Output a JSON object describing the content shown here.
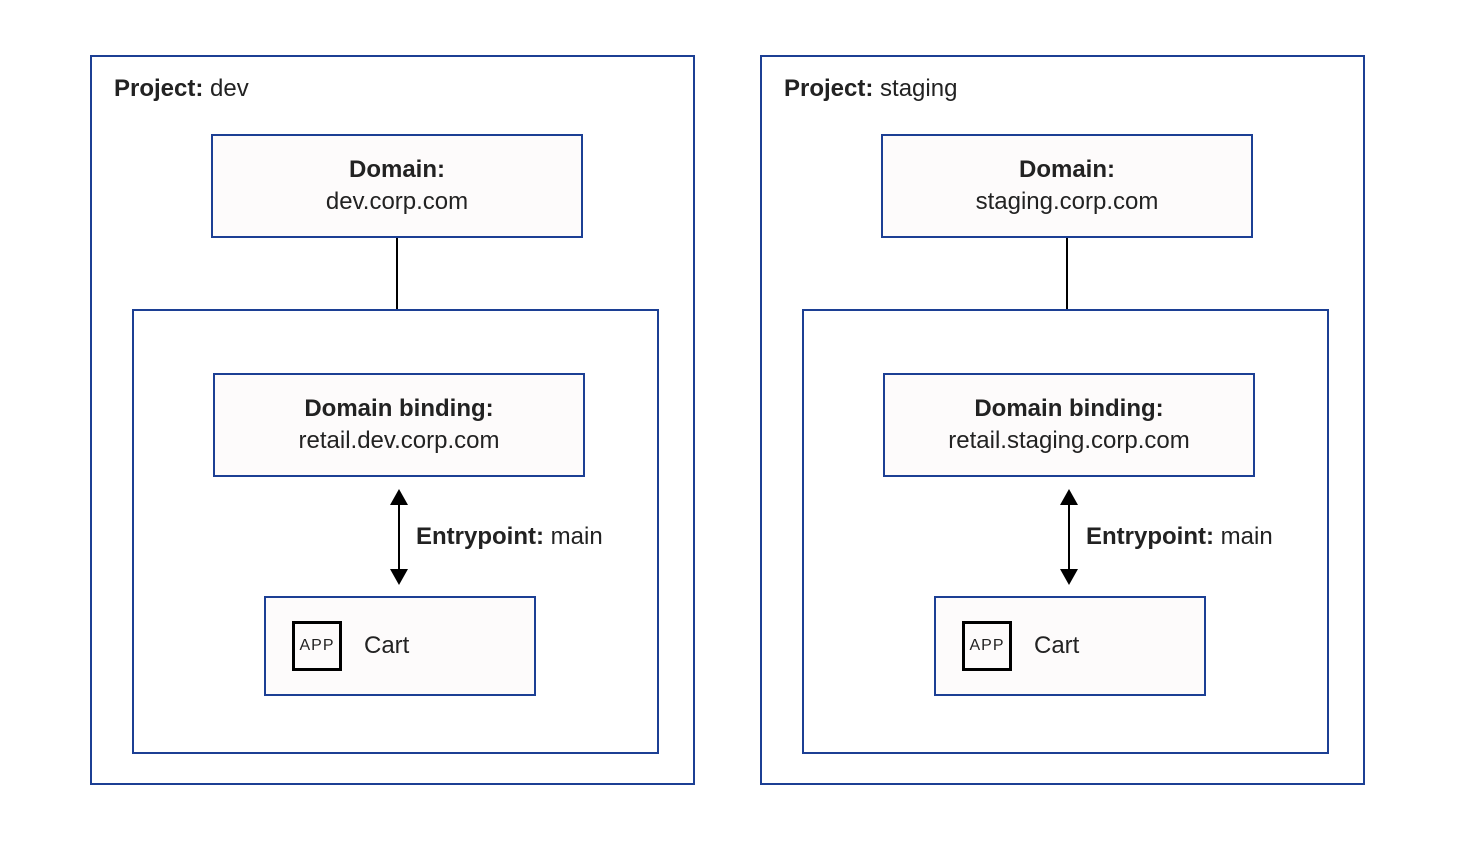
{
  "projects": [
    {
      "labelPrefix": "Project:",
      "name": "dev",
      "domainPrefix": "Domain:",
      "domain": "dev.corp.com",
      "bindingPrefix": "Domain binding:",
      "binding": "retail.dev.corp.com",
      "entryPrefix": "Entrypoint:",
      "entry": "main",
      "appBadge": "APP",
      "appName": "Cart"
    },
    {
      "labelPrefix": "Project:",
      "name": "staging",
      "domainPrefix": "Domain:",
      "domain": "staging.corp.com",
      "bindingPrefix": "Domain binding:",
      "binding": "retail.staging.corp.com",
      "entryPrefix": "Entrypoint:",
      "entry": "main",
      "appBadge": "APP",
      "appName": "Cart"
    }
  ]
}
